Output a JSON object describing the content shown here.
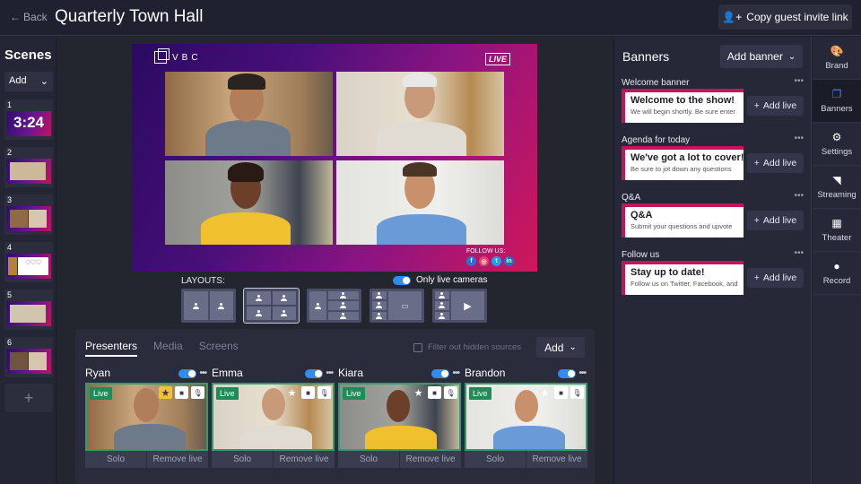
{
  "header": {
    "back_label": "Back",
    "title": "Quarterly Town Hall",
    "invite_label": "Copy guest invite link"
  },
  "scenes": {
    "title": "Scenes",
    "add_label": "Add",
    "items": [
      {
        "number": "1",
        "content": "3:24"
      },
      {
        "number": "2",
        "content": ""
      },
      {
        "number": "3",
        "content": ""
      },
      {
        "number": "4",
        "content": ""
      },
      {
        "number": "5",
        "content": ""
      },
      {
        "number": "6",
        "content": ""
      }
    ],
    "add_scene_label": "+"
  },
  "stage": {
    "logo_text": "VBC",
    "live_label": "LIVE",
    "follow_label": "FOLLOW US:",
    "social": [
      {
        "icon": "facebook-icon",
        "glyph": "f",
        "color": "#2d6fd6"
      },
      {
        "icon": "instagram-icon",
        "glyph": "◎",
        "color": "#d9466f"
      },
      {
        "icon": "twitter-icon",
        "glyph": "t",
        "color": "#1ea0f0"
      },
      {
        "icon": "linkedin-icon",
        "glyph": "in",
        "color": "#1a73c2"
      }
    ]
  },
  "layouts": {
    "label": "LAYOUTS:",
    "only_live_label": "Only live cameras",
    "only_live_on": true,
    "selected_index": 1
  },
  "sources": {
    "tabs": [
      {
        "label": "Presenters",
        "active": true
      },
      {
        "label": "Media",
        "active": false
      },
      {
        "label": "Screens",
        "active": false
      }
    ],
    "filter_label": "Filter out hidden sources",
    "filter_checked": false,
    "add_label": "Add",
    "presenters": [
      {
        "name": "Ryan",
        "badge": "Live",
        "starred": true,
        "solo_label": "Solo",
        "remove_label": "Remove live"
      },
      {
        "name": "Emma",
        "badge": "Live",
        "starred": false,
        "solo_label": "Solo",
        "remove_label": "Remove live"
      },
      {
        "name": "Kiara",
        "badge": "Live",
        "starred": false,
        "solo_label": "Solo",
        "remove_label": "Remove live"
      },
      {
        "name": "Brandon",
        "badge": "Live",
        "starred": false,
        "solo_label": "Solo",
        "remove_label": "Remove live"
      }
    ]
  },
  "banners": {
    "title": "Banners",
    "add_label": "Add banner",
    "add_live_label": "Add live",
    "groups": [
      {
        "label": "Welcome banner",
        "heading": "Welcome to the show!",
        "sub": "We will begin shortly. Be sure enter"
      },
      {
        "label": "Agenda for today",
        "heading": "We've got a lot to cover!",
        "sub": "Be sure to jot down any questions"
      },
      {
        "label": "Q&A",
        "heading": "Q&A",
        "sub": "Submit your questions and upvote"
      },
      {
        "label": "Follow us",
        "heading": "Stay up to date!",
        "sub": "Follow us on Twitter, Facebook, and"
      }
    ]
  },
  "rail": {
    "items": [
      {
        "label": "Brand",
        "icon": "palette-icon",
        "active": false
      },
      {
        "label": "Banners",
        "icon": "banners-icon",
        "active": true
      },
      {
        "label": "Settings",
        "icon": "gear-icon",
        "active": false
      },
      {
        "label": "Streaming",
        "icon": "rss-icon",
        "active": false
      },
      {
        "label": "Theater",
        "icon": "film-icon",
        "active": false
      },
      {
        "label": "Record",
        "icon": "record-icon",
        "active": false
      }
    ]
  },
  "colors": {
    "accent": "#2f8cf0",
    "live_green": "#1f8c58",
    "banner_brand": "#c4145c",
    "star_active": "#f5c330"
  }
}
